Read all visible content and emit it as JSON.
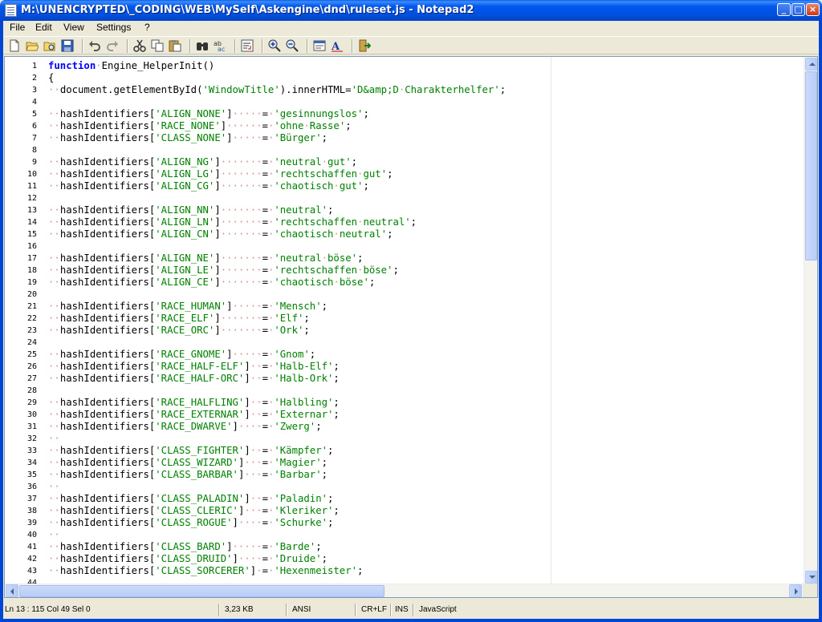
{
  "window": {
    "title": "M:\\UNENCRYPTED\\_CODING\\WEB\\MySelf\\Askengine\\dnd\\ruleset.js - Notepad2",
    "minimize_glyph": "_",
    "maximize_glyph": "□",
    "close_glyph": "×"
  },
  "menu": [
    "File",
    "Edit",
    "View",
    "Settings",
    "?"
  ],
  "toolbar": {
    "buttons": [
      "new-file-icon",
      "open-folder-icon",
      "browse-icon",
      "save-icon",
      "undo-icon",
      "redo-icon",
      "cut-icon",
      "copy-icon",
      "paste-icon",
      "find-icon",
      "replace-icon",
      "word-wrap-icon",
      "zoom-in-icon",
      "zoom-out-icon",
      "scheme-icon",
      "font-icon",
      "exit-icon"
    ]
  },
  "editor": {
    "lines": [
      {
        "n": "1",
        "t": "<span class='kw'>function</span><span class='ws'>·</span>Engine_HelperInit()"
      },
      {
        "n": "2",
        "t": "{"
      },
      {
        "n": "3",
        "t": "<span class='ws'>··</span>document.getElementById(<span class='str'>'WindowTitle'</span>).innerHTML=<span class='str'>'D&amp;amp;D<span class='ws'>·</span>Charakterhelfer'</span>;"
      },
      {
        "n": "4",
        "t": ""
      },
      {
        "n": "5",
        "t": "<span class='ws'>··</span>hashIdentifiers[<span class='str'>'ALIGN_NONE'</span>]<span class='ws'>·····</span>=<span class='ws'>·</span><span class='str'>'gesinnungslos'</span>;"
      },
      {
        "n": "6",
        "t": "<span class='ws'>··</span>hashIdentifiers[<span class='str'>'RACE_NONE'</span>]<span class='ws'>······</span>=<span class='ws'>·</span><span class='str'>'ohne<span class='ws'>·</span>Rasse'</span>;"
      },
      {
        "n": "7",
        "t": "<span class='ws'>··</span>hashIdentifiers[<span class='str'>'CLASS_NONE'</span>]<span class='ws'>·····</span>=<span class='ws'>·</span><span class='str'>'Bürger'</span>;"
      },
      {
        "n": "8",
        "t": ""
      },
      {
        "n": "9",
        "t": "<span class='ws'>··</span>hashIdentifiers[<span class='str'>'ALIGN_NG'</span>]<span class='ws'>·······</span>=<span class='ws'>·</span><span class='str'>'neutral<span class='ws'>·</span>gut'</span>;"
      },
      {
        "n": "10",
        "t": "<span class='ws'>··</span>hashIdentifiers[<span class='str'>'ALIGN_LG'</span>]<span class='ws'>·······</span>=<span class='ws'>·</span><span class='str'>'rechtschaffen<span class='ws'>·</span>gut'</span>;"
      },
      {
        "n": "11",
        "t": "<span class='ws'>··</span>hashIdentifiers[<span class='str'>'ALIGN_CG'</span>]<span class='ws'>·······</span>=<span class='ws'>·</span><span class='str'>'chaotisch<span class='ws'>·</span>gut'</span>;"
      },
      {
        "n": "12",
        "t": ""
      },
      {
        "n": "13",
        "t": "<span class='ws'>··</span>hashIdentifiers[<span class='str'>'ALIGN_NN'</span>]<span class='ws'>·······</span>=<span class='ws'>·</span><span class='str'>'neutral'</span>;"
      },
      {
        "n": "14",
        "t": "<span class='ws'>··</span>hashIdentifiers[<span class='str'>'ALIGN_LN'</span>]<span class='ws'>·······</span>=<span class='ws'>·</span><span class='str'>'rechtschaffen<span class='ws'>·</span>neutral'</span>;"
      },
      {
        "n": "15",
        "t": "<span class='ws'>··</span>hashIdentifiers[<span class='str'>'ALIGN_CN'</span>]<span class='ws'>·······</span>=<span class='ws'>·</span><span class='str'>'chaotisch<span class='ws'>·</span>neutral'</span>;"
      },
      {
        "n": "16",
        "t": ""
      },
      {
        "n": "17",
        "t": "<span class='ws'>··</span>hashIdentifiers[<span class='str'>'ALIGN_NE'</span>]<span class='ws'>·······</span>=<span class='ws'>·</span><span class='str'>'neutral<span class='ws'>·</span>böse'</span>;"
      },
      {
        "n": "18",
        "t": "<span class='ws'>··</span>hashIdentifiers[<span class='str'>'ALIGN_LE'</span>]<span class='ws'>·······</span>=<span class='ws'>·</span><span class='str'>'rechtschaffen<span class='ws'>·</span>böse'</span>;"
      },
      {
        "n": "19",
        "t": "<span class='ws'>··</span>hashIdentifiers[<span class='str'>'ALIGN_CE'</span>]<span class='ws'>·······</span>=<span class='ws'>·</span><span class='str'>'chaotisch<span class='ws'>·</span>böse'</span>;"
      },
      {
        "n": "20",
        "t": ""
      },
      {
        "n": "21",
        "t": "<span class='ws'>··</span>hashIdentifiers[<span class='str'>'RACE_HUMAN'</span>]<span class='ws'>·····</span>=<span class='ws'>·</span><span class='str'>'Mensch'</span>;"
      },
      {
        "n": "22",
        "t": "<span class='ws'>··</span>hashIdentifiers[<span class='str'>'RACE_ELF'</span>]<span class='ws'>·······</span>=<span class='ws'>·</span><span class='str'>'Elf'</span>;"
      },
      {
        "n": "23",
        "t": "<span class='ws'>··</span>hashIdentifiers[<span class='str'>'RACE_ORC'</span>]<span class='ws'>·······</span>=<span class='ws'>·</span><span class='str'>'Ork'</span>;"
      },
      {
        "n": "24",
        "t": ""
      },
      {
        "n": "25",
        "t": "<span class='ws'>··</span>hashIdentifiers[<span class='str'>'RACE_GNOME'</span>]<span class='ws'>·····</span>=<span class='ws'>·</span><span class='str'>'Gnom'</span>;"
      },
      {
        "n": "26",
        "t": "<span class='ws'>··</span>hashIdentifiers[<span class='str'>'RACE_HALF-ELF'</span>]<span class='ws'>··</span>=<span class='ws'>·</span><span class='str'>'Halb-Elf'</span>;"
      },
      {
        "n": "27",
        "t": "<span class='ws'>··</span>hashIdentifiers[<span class='str'>'RACE_HALF-ORC'</span>]<span class='ws'>··</span>=<span class='ws'>·</span><span class='str'>'Halb-Ork'</span>;"
      },
      {
        "n": "28",
        "t": ""
      },
      {
        "n": "29",
        "t": "<span class='ws'>··</span>hashIdentifiers[<span class='str'>'RACE_HALFLING'</span>]<span class='ws'>··</span>=<span class='ws'>·</span><span class='str'>'Halbling'</span>;"
      },
      {
        "n": "30",
        "t": "<span class='ws'>··</span>hashIdentifiers[<span class='str'>'RACE_EXTERNAR'</span>]<span class='ws'>··</span>=<span class='ws'>·</span><span class='str'>'Externar'</span>;"
      },
      {
        "n": "31",
        "t": "<span class='ws'>··</span>hashIdentifiers[<span class='str'>'RACE_DWARVE'</span>]<span class='ws'>····</span>=<span class='ws'>·</span><span class='str'>'Zwerg'</span>;"
      },
      {
        "n": "32",
        "t": "<span class='ws'>··</span>"
      },
      {
        "n": "33",
        "t": "<span class='ws'>··</span>hashIdentifiers[<span class='str'>'CLASS_FIGHTER'</span>]<span class='ws'>··</span>=<span class='ws'>·</span><span class='str'>'Kämpfer'</span>;"
      },
      {
        "n": "34",
        "t": "<span class='ws'>··</span>hashIdentifiers[<span class='str'>'CLASS_WIZARD'</span>]<span class='ws'>···</span>=<span class='ws'>·</span><span class='str'>'Magier'</span>;"
      },
      {
        "n": "35",
        "t": "<span class='ws'>··</span>hashIdentifiers[<span class='str'>'CLASS_BARBAR'</span>]<span class='ws'>···</span>=<span class='ws'>·</span><span class='str'>'Barbar'</span>;"
      },
      {
        "n": "36",
        "t": "<span class='ws'>··</span>"
      },
      {
        "n": "37",
        "t": "<span class='ws'>··</span>hashIdentifiers[<span class='str'>'CLASS_PALADIN'</span>]<span class='ws'>··</span>=<span class='ws'>·</span><span class='str'>'Paladin'</span>;"
      },
      {
        "n": "38",
        "t": "<span class='ws'>··</span>hashIdentifiers[<span class='str'>'CLASS_CLERIC'</span>]<span class='ws'>···</span>=<span class='ws'>·</span><span class='str'>'Kleriker'</span>;"
      },
      {
        "n": "39",
        "t": "<span class='ws'>··</span>hashIdentifiers[<span class='str'>'CLASS_ROGUE'</span>]<span class='ws'>····</span>=<span class='ws'>·</span><span class='str'>'Schurke'</span>;"
      },
      {
        "n": "40",
        "t": "<span class='ws'>··</span>"
      },
      {
        "n": "41",
        "t": "<span class='ws'>··</span>hashIdentifiers[<span class='str'>'CLASS_BARD'</span>]<span class='ws'>·····</span>=<span class='ws'>·</span><span class='str'>'Barde'</span>;"
      },
      {
        "n": "42",
        "t": "<span class='ws'>··</span>hashIdentifiers[<span class='str'>'CLASS_DRUID'</span>]<span class='ws'>····</span>=<span class='ws'>·</span><span class='str'>'Druide'</span>;"
      },
      {
        "n": "43",
        "t": "<span class='ws'>··</span>hashIdentifiers[<span class='str'>'CLASS_SORCERER'</span>]<span class='ws'>·</span>=<span class='ws'>·</span><span class='str'>'Hexenmeister'</span>;"
      },
      {
        "n": "44",
        "t": ""
      }
    ]
  },
  "status": {
    "position": "Ln 13 : 115   Col 49   Sel 0",
    "size": "3,23 KB",
    "encoding": "ANSI",
    "line_endings": "CR+LF",
    "insert_mode": "INS",
    "language": "JavaScript"
  },
  "colors": {
    "keyword": "#0000FF",
    "string": "#008000",
    "whitespace_marker": "#D89090",
    "titlebar": "#0058EE"
  }
}
